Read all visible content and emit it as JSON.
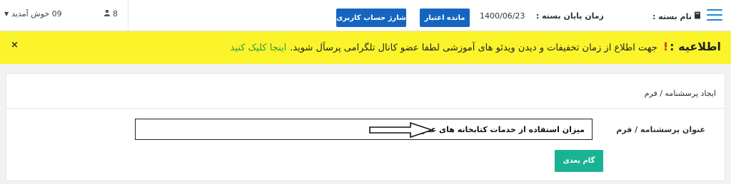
{
  "header": {
    "welcome_text": "09 خوش آمدید",
    "user_count": "8",
    "charge_button": "شارژ حساب کاربری",
    "credit_button": "مانده اعتبار",
    "end_date_label": "زمان پایان بسته :",
    "end_date_value": "1400/06/23",
    "package_label": "نام بسته :"
  },
  "notice": {
    "title": "اطلاعیه :",
    "exclamation": "!",
    "message": "جهت اطلاع از زمان تخفیفات و دیدن ویدئو های آموزشی لطفا عضو کانال تلگرامی پرسآل شوید.",
    "link_text": "اینجا کلیک کنید",
    "close_glyph": "×"
  },
  "form": {
    "breadcrumb": "ایجاد پرسشنامه / فرم",
    "title_label": "عنوان پرسشنامه / فرم",
    "title_value": "میزان استفاده از خدمات کتابخانه های عمومی",
    "next_button": "گام بعدی"
  },
  "colors": {
    "accent_blue": "#1565c0",
    "notice_yellow": "#fbf42a",
    "link_green": "#2e9d3e",
    "next_green": "#19b394",
    "hamburger_blue": "#1e88c7"
  },
  "icons": {
    "user_menu": "caret-down-icon",
    "users": "user-icon",
    "package": "book-icon",
    "menu": "hamburger-icon",
    "close": "close-icon",
    "pointer": "arrow-right-icon"
  }
}
